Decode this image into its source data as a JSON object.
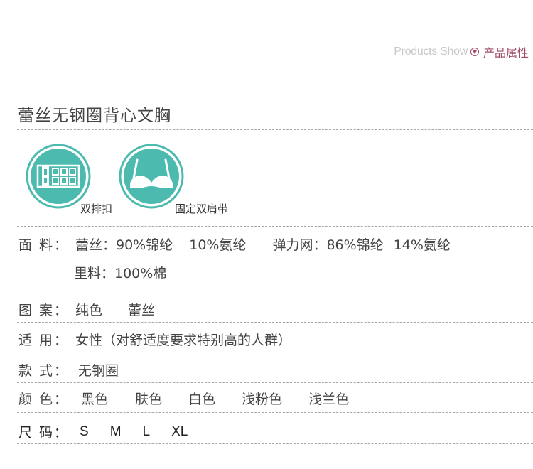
{
  "header": {
    "en_label": "Products Show",
    "cn_label": "产品属性"
  },
  "product_title": "蕾丝无钢圈背心文胸",
  "features": [
    {
      "label": "双排扣",
      "icon": "double-row-hook-icon"
    },
    {
      "label": "固定双肩带",
      "icon": "fixed-shoulder-strap-bra-icon"
    }
  ],
  "colors": {
    "icon_teal": "#4dbab0",
    "header_accent": "#a04a64",
    "header_gray": "#c8c8c8",
    "text": "#444444"
  },
  "attributes": {
    "fabric": {
      "label": "面 料：",
      "values": [
        "蕾丝：90%锦纶",
        "10%氨纶",
        "弹力网：86%锦纶",
        "14%氨纶"
      ],
      "lining": "里料：100%棉"
    },
    "pattern": {
      "label": "图 案：",
      "values": [
        "纯色",
        "蕾丝"
      ]
    },
    "suitable": {
      "label": "适 用：",
      "value": "女性（对舒适度要求特别高的人群）"
    },
    "style": {
      "label": "款 式：",
      "value": "无钢圈"
    },
    "color": {
      "label": "颜 色：",
      "values": [
        "黑色",
        "肤色",
        "白色",
        "浅粉色",
        "浅兰色"
      ]
    },
    "size": {
      "label": "尺 码：",
      "values": [
        "S",
        "M",
        "L",
        "XL"
      ]
    }
  }
}
